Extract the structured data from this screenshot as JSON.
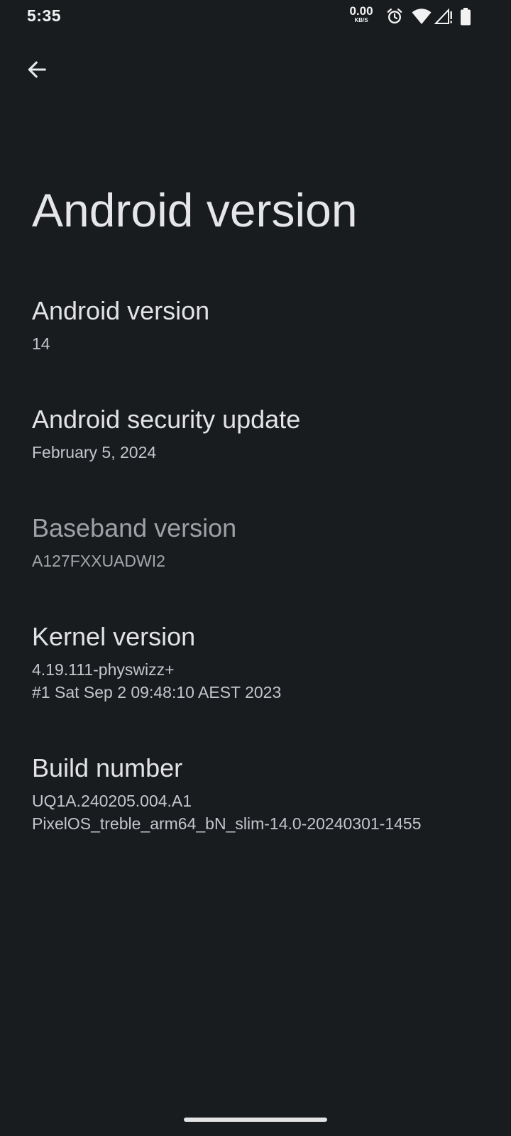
{
  "status_bar": {
    "time": "5:35",
    "net_speed_value": "0.00",
    "net_speed_unit": "KB/S",
    "icons": [
      "alarm-icon",
      "wifi-icon",
      "cell-signal-icon",
      "battery-icon"
    ]
  },
  "header": {
    "back_icon": "arrow-back-icon",
    "title": "Android version"
  },
  "items": [
    {
      "title": "Android version",
      "summary": [
        "14"
      ],
      "enabled": true
    },
    {
      "title": "Android security update",
      "summary": [
        "February 5, 2024"
      ],
      "enabled": true
    },
    {
      "title": "Baseband version",
      "summary": [
        "A127FXXUADWI2"
      ],
      "enabled": false
    },
    {
      "title": "Kernel version",
      "summary": [
        "4.19.111-physwizz+",
        "#1 Sat Sep 2 09:48:10 AEST 2023"
      ],
      "enabled": true
    },
    {
      "title": "Build number",
      "summary": [
        "UQ1A.240205.004.A1",
        "PixelOS_treble_arm64_bN_slim-14.0-20240301-1455"
      ],
      "enabled": true
    }
  ],
  "colors": {
    "background": "#191c1e",
    "text_primary": "#e3e3e7",
    "text_secondary": "#c3c6cc",
    "text_disabled": "#9fa1a6"
  }
}
